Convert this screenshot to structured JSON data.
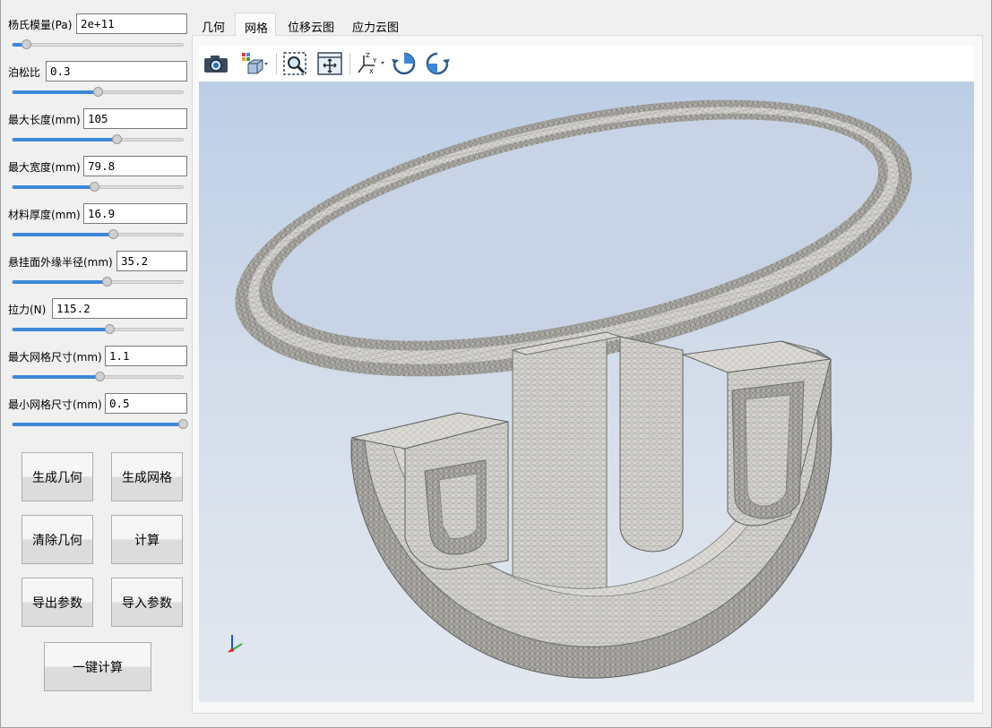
{
  "params": [
    {
      "label": "杨氏模量(Pa)",
      "value": "2e+11",
      "slider": 0.08
    },
    {
      "label": "泊松比",
      "value": "0.3",
      "slider": 0.5
    },
    {
      "label": "最大长度(mm)",
      "value": "105",
      "slider": 0.61
    },
    {
      "label": "最大宽度(mm)",
      "value": "79.8",
      "slider": 0.48
    },
    {
      "label": "材料厚度(mm)",
      "value": "16.9",
      "slider": 0.59
    },
    {
      "label": "悬挂面外缘半径(mm)",
      "value": "35.2",
      "slider": 0.55
    },
    {
      "label": "拉力(N)",
      "value": "115.2",
      "slider": 0.57
    },
    {
      "label": "最大网格尺寸(mm)",
      "value": "1.1",
      "slider": 0.51
    },
    {
      "label": "最小网格尺寸(mm)",
      "value": "0.5",
      "slider": 1.0
    }
  ],
  "buttons": {
    "generate_geometry": "生成几何",
    "generate_mesh": "生成网格",
    "clear_geometry": "清除几何",
    "compute": "计算",
    "export_params": "导出参数",
    "import_params": "导入参数",
    "one_click_compute": "一键计算"
  },
  "tabs": [
    {
      "label": "几何",
      "active": false
    },
    {
      "label": "网格",
      "active": true
    },
    {
      "label": "位移云图",
      "active": false
    },
    {
      "label": "应力云图",
      "active": false
    }
  ],
  "toolbar_icons": [
    "camera-icon",
    "view-cube-icon",
    "zoom-box-icon",
    "fit-all-icon",
    "axes-icon",
    "rotate-cw-icon",
    "rotate-ccw-icon"
  ],
  "axes_labels": {
    "x": "X",
    "y": "Y",
    "z": "Z"
  },
  "colors": {
    "slider_fill": "#3c88d8",
    "viewport_top": "#bccee6",
    "viewport_bottom": "#e3e8ef",
    "mesh_surface": "#d4d2cc",
    "mesh_edge": "#8a8a8a"
  }
}
